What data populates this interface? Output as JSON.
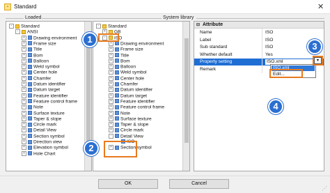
{
  "window": {
    "title": "Standard",
    "icon": "app-icon"
  },
  "groups": {
    "loaded": "Loaded",
    "library": "System library"
  },
  "loaded_tree": [
    {
      "label": "Standard",
      "level": 0,
      "exp": "-"
    },
    {
      "label": "ANSI",
      "level": 1,
      "exp": "-"
    },
    {
      "label": "Drawing environment",
      "level": 2,
      "exp": "+"
    },
    {
      "label": "Frame size",
      "level": 2,
      "exp": "+"
    },
    {
      "label": "Title",
      "level": 2,
      "exp": "+"
    },
    {
      "label": "Bom",
      "level": 2,
      "exp": "+"
    },
    {
      "label": "Balloon",
      "level": 2,
      "exp": "+"
    },
    {
      "label": "Weld symbol",
      "level": 2,
      "exp": "+"
    },
    {
      "label": "Center hole",
      "level": 2,
      "exp": "+"
    },
    {
      "label": "Chamfer",
      "level": 2,
      "exp": "+"
    },
    {
      "label": "Datum identifier",
      "level": 2,
      "exp": "+"
    },
    {
      "label": "Datum target",
      "level": 2,
      "exp": "+"
    },
    {
      "label": "Feature identifier",
      "level": 2,
      "exp": "+"
    },
    {
      "label": "Feature control frame",
      "level": 2,
      "exp": "+"
    },
    {
      "label": "Note",
      "level": 2,
      "exp": "+"
    },
    {
      "label": "Surface texture",
      "level": 2,
      "exp": "+"
    },
    {
      "label": "Taper & slope",
      "level": 2,
      "exp": "+"
    },
    {
      "label": "Circle mark",
      "level": 2,
      "exp": "+"
    },
    {
      "label": "Detail View",
      "level": 2,
      "exp": "+"
    },
    {
      "label": "Section symbol",
      "level": 2,
      "exp": "+"
    },
    {
      "label": "Direction view",
      "level": 2,
      "exp": "+"
    },
    {
      "label": "Elevation symbol",
      "level": 2,
      "exp": "+"
    },
    {
      "label": "Hole Chart",
      "level": 2,
      "exp": "+"
    }
  ],
  "library_tree": [
    {
      "label": "Standard",
      "level": 0,
      "exp": "-"
    },
    {
      "label": "GB",
      "level": 1,
      "exp": "+"
    },
    {
      "label": "ISO",
      "level": 1,
      "exp": "-"
    },
    {
      "label": "Drawing environment",
      "level": 2,
      "exp": "+"
    },
    {
      "label": "Frame size",
      "level": 2,
      "exp": "+"
    },
    {
      "label": "Title",
      "level": 2,
      "exp": "+"
    },
    {
      "label": "Bom",
      "level": 2,
      "exp": "+"
    },
    {
      "label": "Balloon",
      "level": 2,
      "exp": "+"
    },
    {
      "label": "Weld symbol",
      "level": 2,
      "exp": "+"
    },
    {
      "label": "Center hole",
      "level": 2,
      "exp": "+"
    },
    {
      "label": "Chamfer",
      "level": 2,
      "exp": "+"
    },
    {
      "label": "Datum identifier",
      "level": 2,
      "exp": "+"
    },
    {
      "label": "Datum target",
      "level": 2,
      "exp": "+"
    },
    {
      "label": "Feature identifier",
      "level": 2,
      "exp": "+"
    },
    {
      "label": "Feature control frame",
      "level": 2,
      "exp": "+"
    },
    {
      "label": "Note",
      "level": 2,
      "exp": "+"
    },
    {
      "label": "Surface texture",
      "level": 2,
      "exp": "+"
    },
    {
      "label": "Taper & slope",
      "level": 2,
      "exp": "+"
    },
    {
      "label": "Circle mark",
      "level": 2,
      "exp": "+"
    },
    {
      "label": "Detail View",
      "level": 2,
      "exp": "-"
    },
    {
      "label": "ISO",
      "level": 3,
      "exp": ""
    },
    {
      "label": "Section symbol",
      "level": 2,
      "exp": "+"
    }
  ],
  "attributes": {
    "header": "Attribute",
    "rows": [
      {
        "name": "Name",
        "value": "ISO"
      },
      {
        "name": "Label",
        "value": "ISO"
      },
      {
        "name": "Sub standard",
        "value": "ISO"
      },
      {
        "name": "Whether default",
        "value": "Yes"
      },
      {
        "name": "Property setting",
        "value": "ISO.xml"
      },
      {
        "name": "Remark",
        "value": ""
      }
    ],
    "dropdown_options": [
      "ISO.xml",
      "Edit..."
    ]
  },
  "callouts": [
    "1",
    "2",
    "3",
    "4"
  ],
  "buttons": {
    "ok": "OK",
    "cancel": "Cancel"
  },
  "colors": {
    "accent": "#2b6fd1",
    "callout_border": "#e87a1d",
    "selection": "#1f6ed4"
  }
}
